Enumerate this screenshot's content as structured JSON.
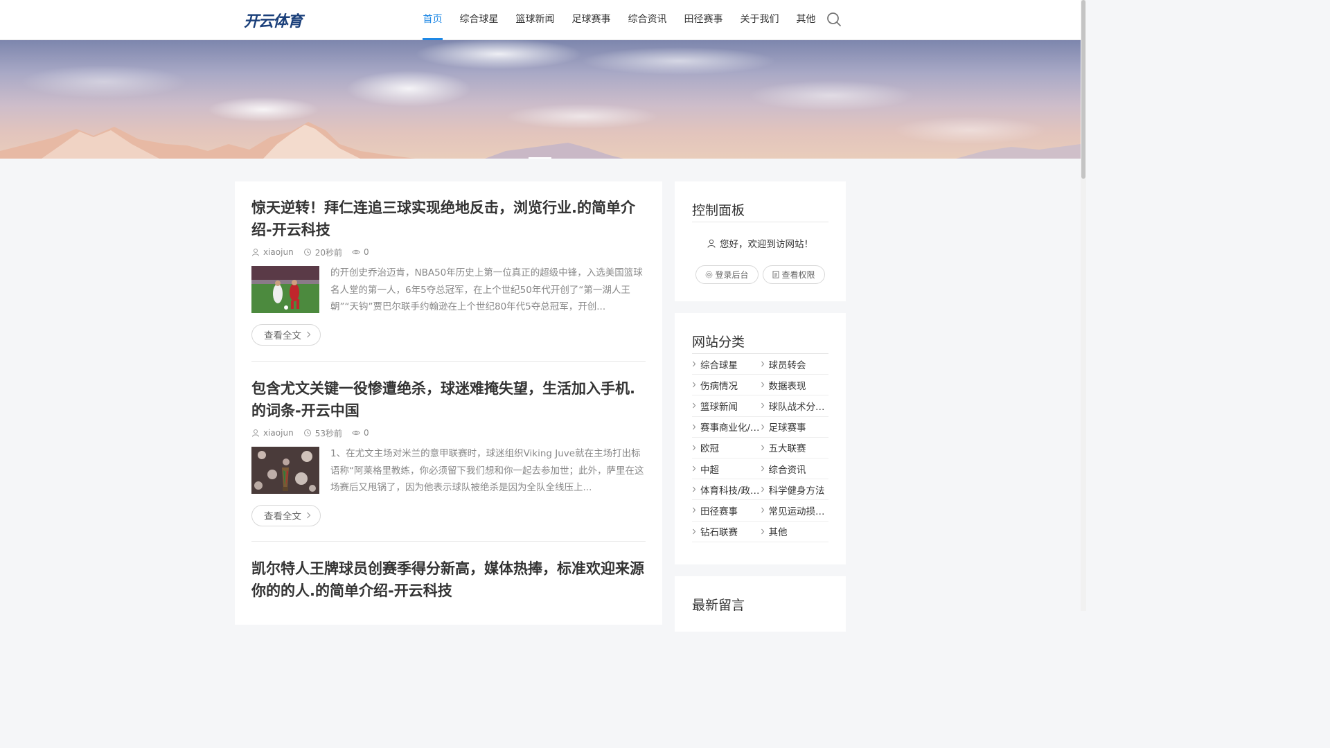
{
  "header": {
    "logo": "开云体育",
    "nav": [
      "首页",
      "综合球星",
      "篮球新闻",
      "足球赛事",
      "综合资讯",
      "田径赛事",
      "关于我们",
      "其他"
    ],
    "active_nav_index": 0,
    "search_icon": "search-icon"
  },
  "colors": {
    "accent": "#1e88e5",
    "logo": "#1a3f7a"
  },
  "posts": [
    {
      "title": "惊天逆转！拜仁连追三球实现绝地反击，浏览行业.的简单介绍-开云科技",
      "author": "xiaojun",
      "time": "20秒前",
      "views": "0",
      "excerpt": "的开创史乔治迈肯，NBA50年历史上第一位真正的超级中锋，入选美国篮球名人堂的第一人，6年5夺总冠军，在上个世纪50年代开创了“第一湖人王朝”“天钩”贾巴尔联手约翰逊在上个世纪80年代5夺总冠军，开创...",
      "read_more": "查看全文"
    },
    {
      "title": "包含尤文关键一役惨遭绝杀，球迷难掩失望，生活加入手机.的词条-开云中国",
      "author": "xiaojun",
      "time": "53秒前",
      "views": "0",
      "excerpt": "1、在尤文主场对米兰的意甲联赛时，球迷组织Viking Juve就在主场打出标语称“阿莱格里教练，你必须留下我们想和你一起去参加世；此外，萨里在这场赛后又甩锅了，因为他表示球队被绝杀是因为全队全线压上...",
      "read_more": "查看全文"
    },
    {
      "title": "凯尔特人王牌球员创赛季得分新高，媒体热捧，标准欢迎来源你的的人.的简单介绍-开云科技"
    }
  ],
  "sidebar": {
    "panel": {
      "title": "控制面板",
      "welcome": "您好，欢迎到访网站！",
      "login": "登录后台",
      "permissions": "查看权限"
    },
    "categories": {
      "title": "网站分类",
      "items": [
        [
          "综合球星",
          "球员转会"
        ],
        [
          "伤病情况",
          "数据表现"
        ],
        [
          "篮球新闻",
          "球队战术分…"
        ],
        [
          "赛事商业化/…",
          "足球赛事"
        ],
        [
          "欧冠",
          "五大联赛"
        ],
        [
          "中超",
          "综合资讯"
        ],
        [
          "体育科技/政…",
          "科学健身方法"
        ],
        [
          "田径赛事",
          "常见运动损…"
        ],
        [
          "钻石联赛",
          "其他"
        ]
      ]
    },
    "comments": {
      "title": "最新留言"
    }
  }
}
